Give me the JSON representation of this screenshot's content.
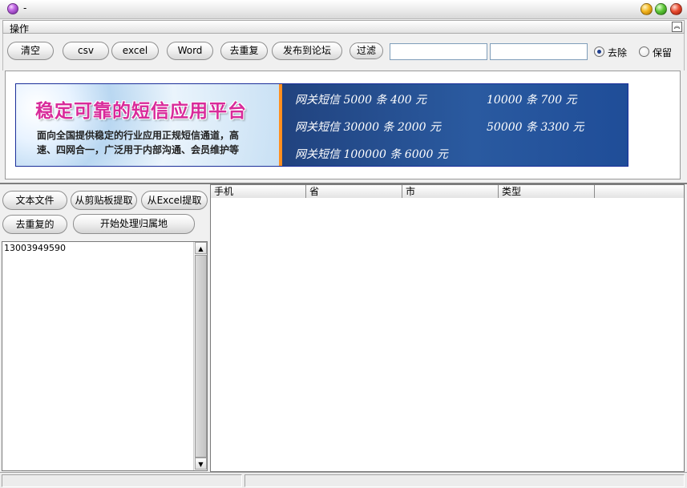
{
  "window": {
    "title": "-"
  },
  "panel": {
    "title": "操作",
    "collapse_glyph": "︽"
  },
  "toolbar": {
    "buttons": [
      "清空",
      "csv",
      "excel",
      "Word",
      "去重复",
      "发布到论坛",
      "过滤"
    ],
    "input1": "",
    "input2": "",
    "radio_remove": "去除",
    "radio_keep": "保留",
    "radio_selected": "remove"
  },
  "banner": {
    "headline": "稳定可靠的短信应用平台",
    "desc_line1": "面向全国提供稳定的行业应用正规短信通道，高",
    "desc_line2": "速、四网合一，广泛用于内部沟通、会员维护等",
    "prices": [
      "网关短信  5000 条  400 元",
      "10000 条  700 元",
      "网关短信  30000 条  2000 元",
      "50000 条  3300 元",
      "网关短信  100000 条 6000 元"
    ],
    "colors": {
      "headline": "#d82a9a",
      "panel_right": "#2a5aa0",
      "stripe": "#ff8f1f",
      "border": "#1b2f9a"
    }
  },
  "left": {
    "buttons": [
      "文本文件",
      "从剪贴板提取",
      "从Excel提取",
      "去重复的",
      "开始处理归属地"
    ],
    "text_content": "13003949590"
  },
  "grid": {
    "columns": [
      "手机",
      "省",
      "市",
      "类型"
    ]
  },
  "icons": {
    "app": "app-orb-icon",
    "minimize": "minimize-icon",
    "maximize": "maximize-icon",
    "close": "close-icon",
    "scroll_up": "▲",
    "scroll_down": "▼"
  }
}
